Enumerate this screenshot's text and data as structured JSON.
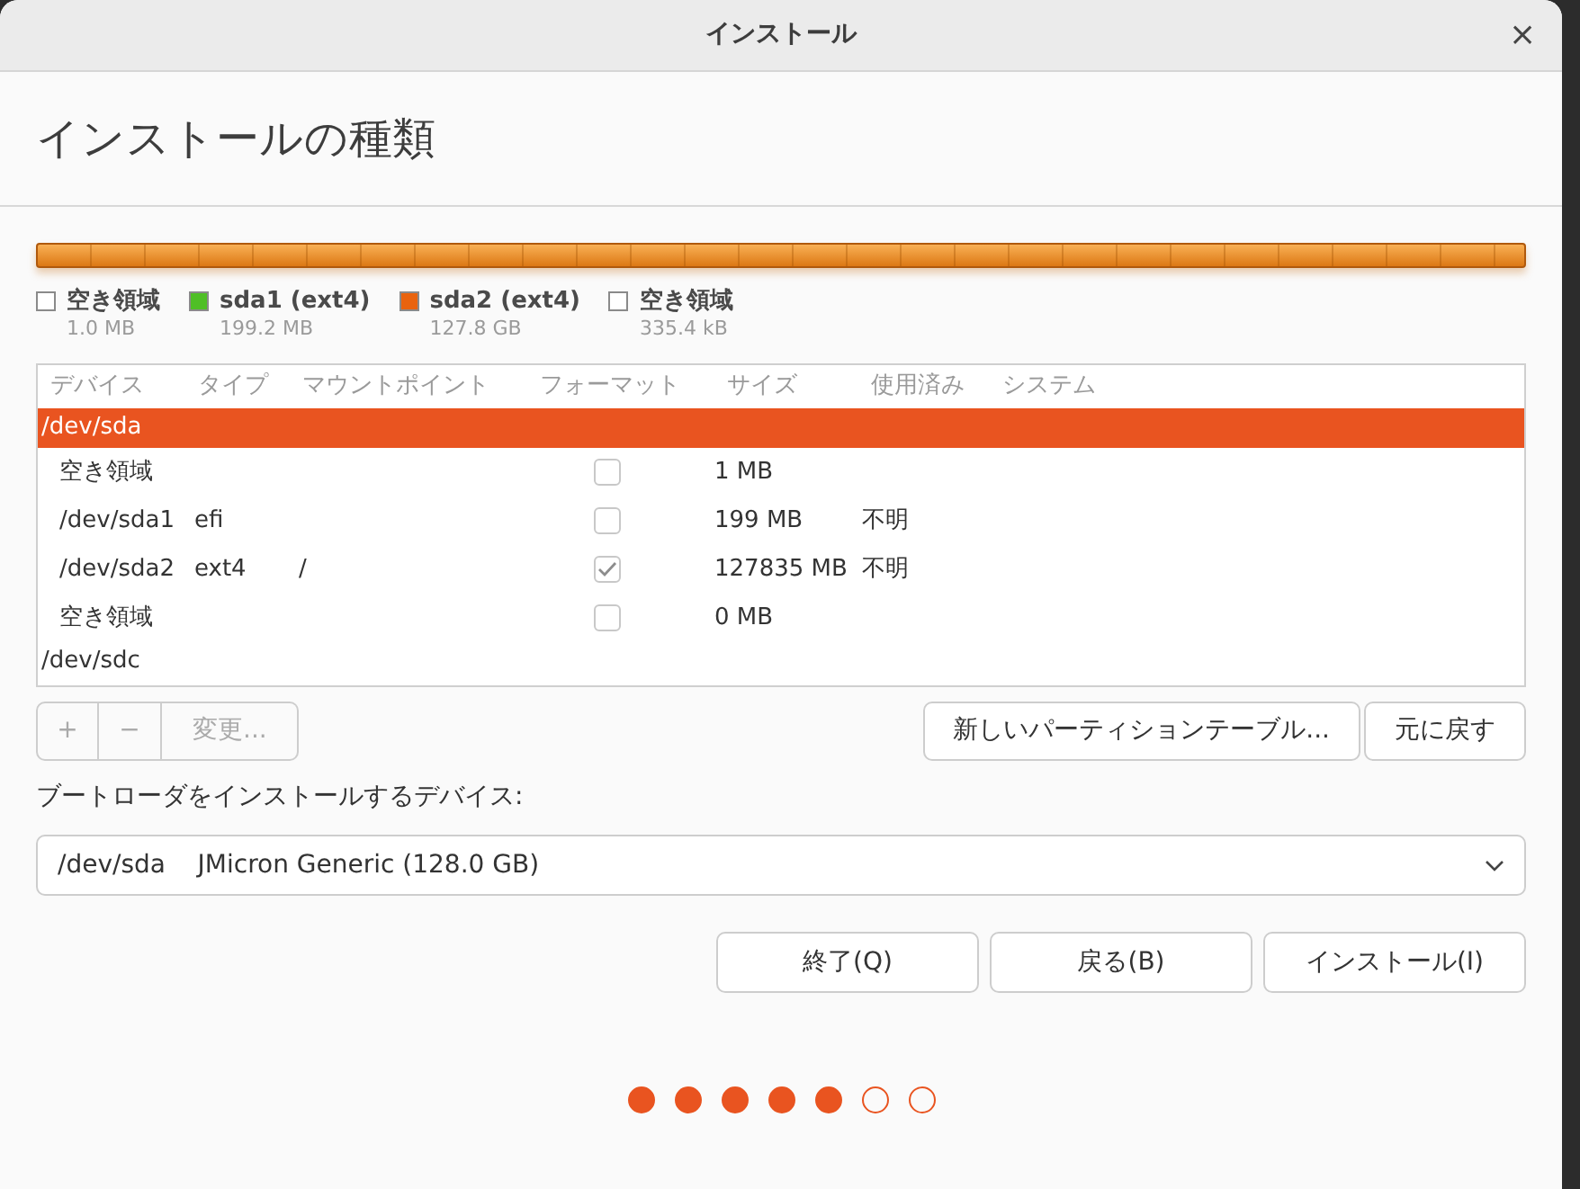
{
  "window": {
    "title": "インストール",
    "close": "×"
  },
  "heading": "インストールの種類",
  "legend": [
    {
      "name": "空き領域",
      "size": "1.0 MB",
      "color": "#ffffff"
    },
    {
      "name": "sda1 (ext4)",
      "size": "199.2 MB",
      "color": "#4fbf26"
    },
    {
      "name": "sda2 (ext4)",
      "size": "127.8 GB",
      "color": "#e9630e"
    },
    {
      "name": "空き領域",
      "size": "335.4 kB",
      "color": "#ffffff"
    }
  ],
  "table": {
    "columns": [
      "デバイス",
      "タイプ",
      "マウントポイント",
      "フォーマット",
      "サイズ",
      "使用済み",
      "システム"
    ],
    "rows": [
      {
        "kind": "disk",
        "device": "/dev/sda",
        "selected": true
      },
      {
        "kind": "partition",
        "device": "空き領域",
        "type": "",
        "mount": "",
        "format": false,
        "size": "1 MB",
        "used": "",
        "selected": false
      },
      {
        "kind": "partition",
        "device": "/dev/sda1",
        "type": "efi",
        "mount": "",
        "format": false,
        "size": "199 MB",
        "used": "不明",
        "selected": false
      },
      {
        "kind": "partition",
        "device": "/dev/sda2",
        "type": "ext4",
        "mount": "/",
        "format": true,
        "size": "127835 MB",
        "used": "不明",
        "selected": false
      },
      {
        "kind": "partition",
        "device": "空き領域",
        "type": "",
        "mount": "",
        "format": false,
        "size": "0 MB",
        "used": "",
        "selected": false
      },
      {
        "kind": "disk",
        "device": "/dev/sdc",
        "selected": false
      }
    ]
  },
  "toolbar": [
    {
      "label": "+",
      "disabled": true
    },
    {
      "label": "−",
      "disabled": true
    },
    {
      "label": "変更...",
      "disabled": true
    }
  ],
  "table_buttons": [
    "新しいパーティションテーブル...",
    "元に戻す"
  ],
  "bootloader": {
    "label": "ブートローダをインストールするデバイス:",
    "value": "/dev/sda    JMicron Generic (128.0 GB)"
  },
  "buttons": [
    "終了(Q)",
    "戻る(B)",
    "インストール(I)"
  ],
  "steps": [
    {
      "done": true
    },
    {
      "done": true
    },
    {
      "done": true
    },
    {
      "done": true
    },
    {
      "done": true
    },
    {
      "done": false
    },
    {
      "done": false
    }
  ]
}
